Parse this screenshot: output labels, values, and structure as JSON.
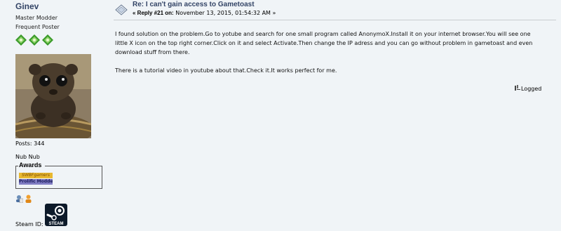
{
  "author": {
    "username": "Ginev",
    "member_group": "Master Modder",
    "post_group": "Frequent Poster",
    "star_icon": "green-gem-star-icon",
    "star_count": 3,
    "posts_label": "Posts: 344",
    "personal_text": "Nub Nub",
    "awards": {
      "legend": "Awards",
      "items": [
        {
          "label": "SWBFgamers"
        },
        {
          "label": "Prolific Modder"
        }
      ]
    },
    "profile_icons": [
      "user-profile-icon",
      "person-icon"
    ],
    "steam_label": "Steam ID:",
    "steam_logo_text": "STEAM"
  },
  "post": {
    "subject": "Re: I can't gain access to Gametoast",
    "reply_prefix": "« Reply #21 on:",
    "date": " November 13, 2015, 01:54:32 AM »",
    "paragraphs": [
      "I found solution on the problem.Go to yotube and search for one small program called AnonymoX.Install it on your internet browser.You will see one little X icon on the top right corner.Click on it and select Activate.Then change the IP adress and you can go without problem in gametoast and even download stuff from there.",
      "There is a tutorial video in youtube about that.Check it.It works perfect for me."
    ],
    "logged_label": "Logged"
  },
  "colors": {
    "background": "#f0f4f7",
    "username": "#334466",
    "star_green": "#3a9a2a",
    "award_gold": "#e8b830",
    "award_purple": "#7f7cc2",
    "divider": "#c8ccd0"
  }
}
